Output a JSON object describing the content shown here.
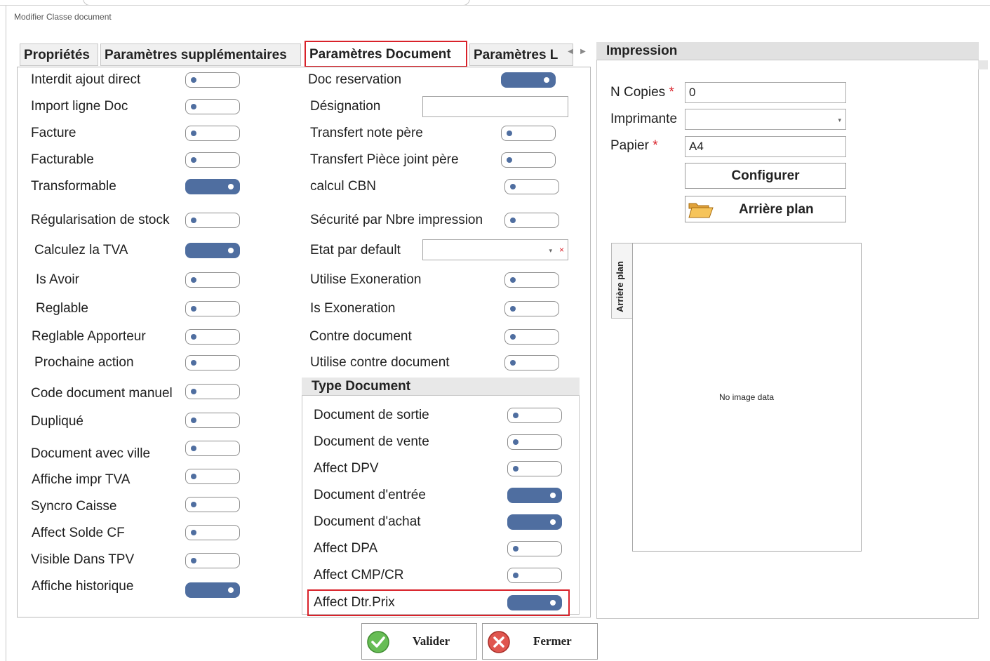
{
  "window": {
    "title": "Modifier Classe document"
  },
  "tabs": [
    {
      "label": "Propriétés"
    },
    {
      "label": "Paramètres supplémentaires"
    },
    {
      "label": "Paramètres Document"
    },
    {
      "label": "Paramètres L"
    }
  ],
  "left_column": [
    {
      "label": "Interdit ajout direct",
      "on": false
    },
    {
      "label": "Import ligne Doc",
      "on": false
    },
    {
      "label": "Facture",
      "on": false
    },
    {
      "label": "Facturable",
      "on": false
    },
    {
      "label": "Transformable",
      "on": true
    },
    {
      "label": "Régularisation de stock",
      "on": false
    },
    {
      "label": "Calculez la TVA",
      "on": true
    },
    {
      "label": "Is Avoir",
      "on": false
    },
    {
      "label": "Reglable",
      "on": false
    },
    {
      "label": "Reglable Apporteur",
      "on": false
    },
    {
      "label": "Prochaine action",
      "on": false
    },
    {
      "label": "Code document manuel",
      "on": false
    },
    {
      "label": "Dupliqué",
      "on": false
    },
    {
      "label": "Document avec ville",
      "on": false
    },
    {
      "label": "Affiche impr TVA",
      "on": false
    },
    {
      "label": "Syncro Caisse",
      "on": false
    },
    {
      "label": "Affect Solde CF",
      "on": false
    },
    {
      "label": "Visible Dans TPV",
      "on": false
    },
    {
      "label": "Affiche historique",
      "on": true
    }
  ],
  "middle_column": {
    "doc_reservation": {
      "label": "Doc reservation",
      "on": true
    },
    "designation": {
      "label": "Désignation",
      "value": ""
    },
    "transfert_note": {
      "label": "Transfert note père",
      "on": false
    },
    "transfert_piece": {
      "label": "Transfert Pièce joint père",
      "on": false
    },
    "calcul_cbn": {
      "label": "calcul CBN",
      "on": false
    },
    "securite": {
      "label": "Sécurité par Nbre impression",
      "on": false
    },
    "etat_defaut": {
      "label": "Etat par default",
      "value": "",
      "clear": "×",
      "arrow": "▾"
    },
    "utilise_exo": {
      "label": "Utilise Exoneration",
      "on": false
    },
    "is_exo": {
      "label": "Is Exoneration",
      "on": false
    },
    "contre_doc": {
      "label": "Contre document",
      "on": false
    },
    "utilise_contre": {
      "label": "Utilise contre document",
      "on": false
    }
  },
  "type_document": {
    "title": "Type Document",
    "items": [
      {
        "label": "Document de sortie",
        "on": false
      },
      {
        "label": "Document de vente",
        "on": false
      },
      {
        "label": "Affect DPV",
        "on": false
      },
      {
        "label": "Document d'entrée",
        "on": true
      },
      {
        "label": "Document d'achat",
        "on": true
      },
      {
        "label": "Affect DPA",
        "on": false
      },
      {
        "label": "Affect CMP/CR",
        "on": false
      },
      {
        "label": "Affect Dtr.Prix",
        "on": true
      }
    ]
  },
  "impression": {
    "title": "Impression",
    "copies": {
      "label": "N Copies",
      "value": "0"
    },
    "imprimante": {
      "label": "Imprimante",
      "value": "",
      "arrow": "▾"
    },
    "papier": {
      "label": "Papier",
      "value": "A4"
    },
    "required_mark": "*",
    "configurer_label": "Configurer",
    "arriere_plan_label": "Arrière plan",
    "vertical_tab_label": "Arrière plan",
    "no_image_text": "No image data"
  },
  "footer": {
    "valider_label": "Valider",
    "fermer_label": "Fermer"
  },
  "colors": {
    "accent_red": "#d9222a",
    "toggle_on": "#4f6ea0",
    "valider_green": "#5cb85c",
    "fermer_red": "#d9534f"
  }
}
